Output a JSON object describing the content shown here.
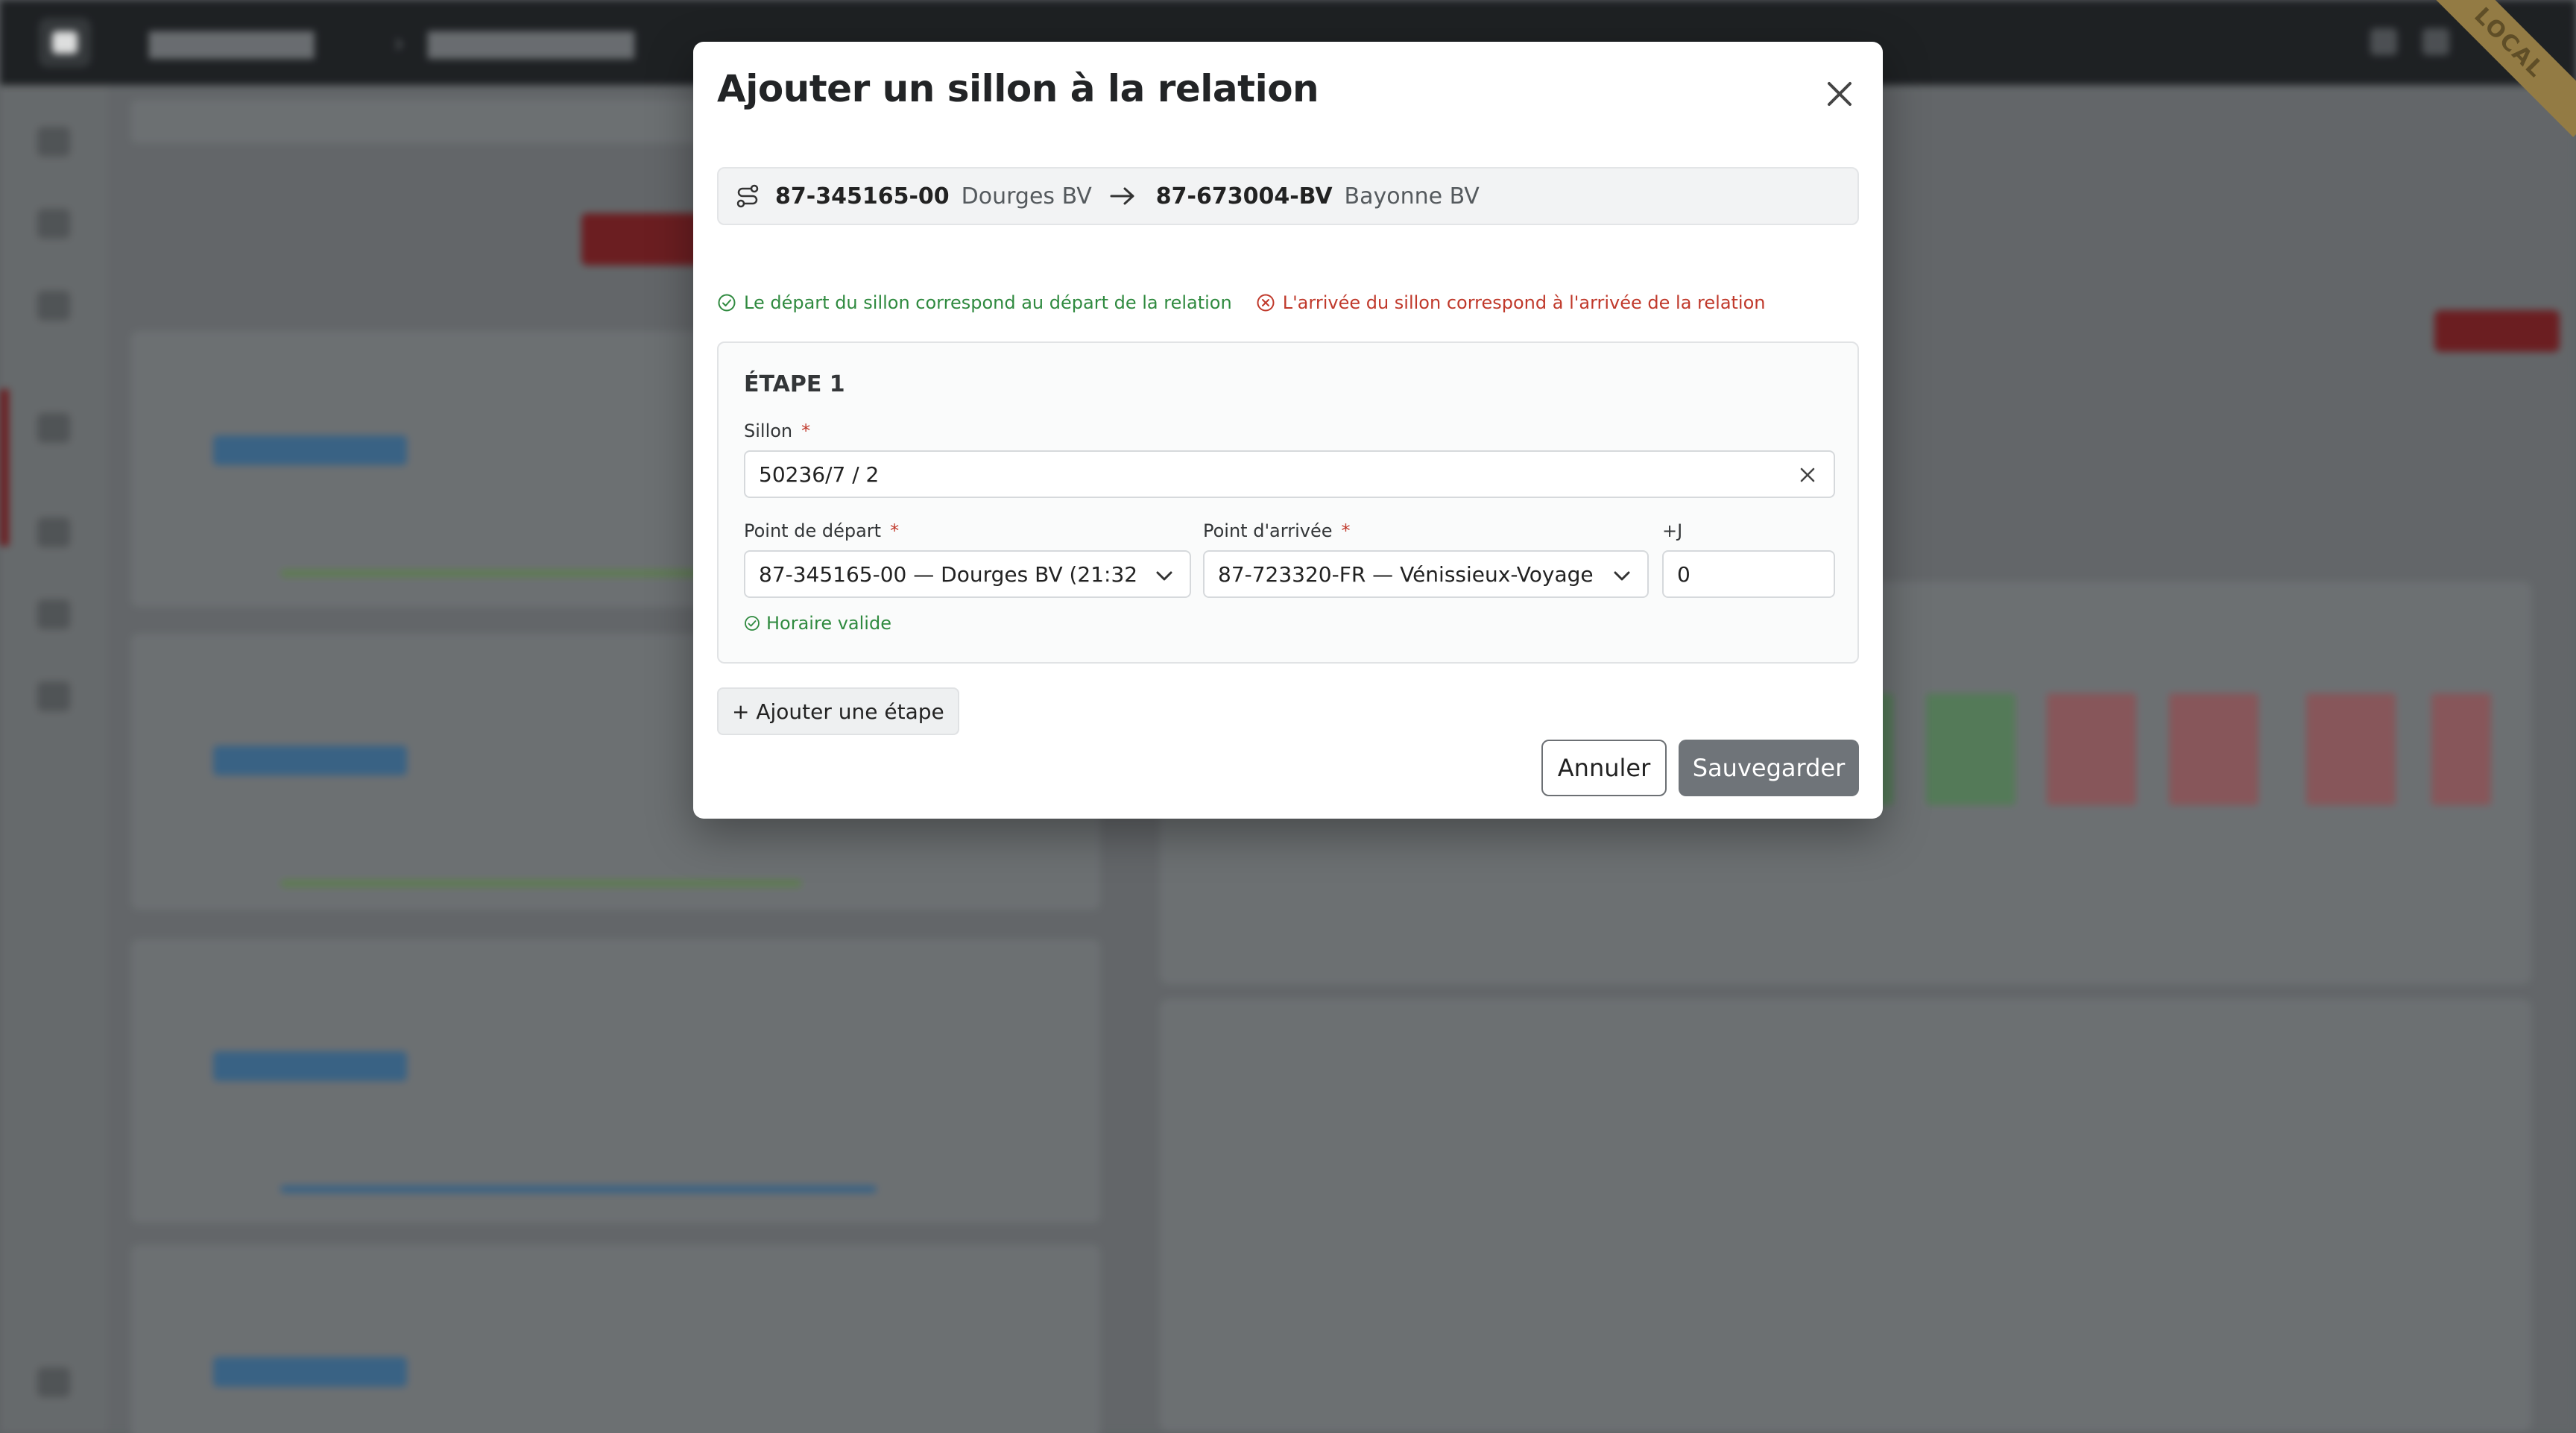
{
  "modal": {
    "title": "Ajouter un sillon à la relation",
    "route": {
      "from_code": "87-345165-00",
      "from_name": "Dourges BV",
      "to_code": "87-673004-BV",
      "to_name": "Bayonne BV"
    },
    "checks": {
      "departure_ok": "Le départ du sillon correspond au départ de la relation",
      "arrival_error": "L'arrivée du sillon correspond à l'arrivée de la relation"
    },
    "step": {
      "title": "ÉTAPE 1",
      "sillon_label": "Sillon",
      "required_mark": "*",
      "sillon_value": "50236/7 / 2",
      "departure_label": "Point de départ",
      "departure_value": "87-345165-00 — Dourges BV (21:32",
      "arrival_label": "Point d'arrivée",
      "arrival_value": "87-723320-FR — Vénissieux-Voyage",
      "day_offset_label": "+J",
      "day_offset_value": "0",
      "valid_message": "Horaire valide"
    },
    "add_step_label": "+ Ajouter une étape",
    "cancel_label": "Annuler",
    "save_label": "Sauvegarder"
  },
  "environment_badge": "LOCAL",
  "colors": {
    "success": "#2f8a3f",
    "error": "#c0392b",
    "save_button": "#6f7479",
    "brand_red": "#7a1e22"
  }
}
